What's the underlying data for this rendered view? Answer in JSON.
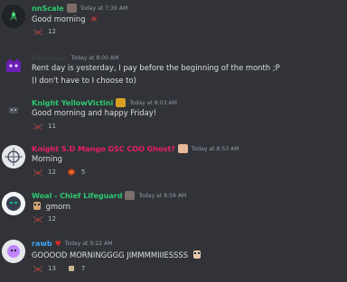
{
  "messages": [
    {
      "username": "nnScale",
      "username_color": "#2dc770",
      "role_icon": "tank-icon",
      "timestamp": "Today at 7:39 AM",
      "lines": [
        "Good morning"
      ],
      "inline_emoji": "spider-icon",
      "reactions": [
        {
          "emoji": "spider-icon",
          "count": "12"
        }
      ]
    },
    {
      "username": "Peberius",
      "username_color": "#3c3f45",
      "timestamp": "Today at 8:00 AM",
      "lines": [
        "Rent day is yesterday, I pay before the beginning of the month ;P",
        "(I don't have to I choose to)"
      ],
      "reactions": []
    },
    {
      "username": "Knight YellowVictini",
      "username_color": "#2dc770",
      "role_icon": "crown-icon",
      "timestamp": "Today at 8:03 AM",
      "lines": [
        "Good morning and happy Friday!"
      ],
      "reactions": [
        {
          "emoji": "spider-icon",
          "count": "11"
        }
      ]
    },
    {
      "username": "Knight S.D Mango GSC COO Ghost?",
      "username_color": "#e91e63",
      "role_icon": "character-icon",
      "timestamp": "Today at 8:53 AM",
      "lines": [
        "Morning"
      ],
      "reactions": [
        {
          "emoji": "spider-icon",
          "count": "12"
        },
        {
          "emoji": "meat-icon",
          "count": "5"
        }
      ]
    },
    {
      "username": "Woal - Chief Lifeguard",
      "username_color": "#2dc770",
      "role_icon": "tank-icon",
      "timestamp": "Today at 8:59 AM",
      "lines": [
        "gmorn"
      ],
      "line_prefix_emoji": "character-icon",
      "reactions": [
        {
          "emoji": "spider-icon",
          "count": "12"
        }
      ]
    },
    {
      "username": "rawb",
      "username_color": "#3ba4f5",
      "role_icon": "heart-icon",
      "timestamp": "Today at 9:22 AM",
      "lines": [
        "GOOOOD MORNINGGGG JIMMMMIIIESSSS"
      ],
      "inline_emoji": "character-icon",
      "reactions": [
        {
          "emoji": "spider-icon",
          "count": "13"
        },
        {
          "emoji": "scroll-icon",
          "count": "7"
        }
      ]
    }
  ]
}
